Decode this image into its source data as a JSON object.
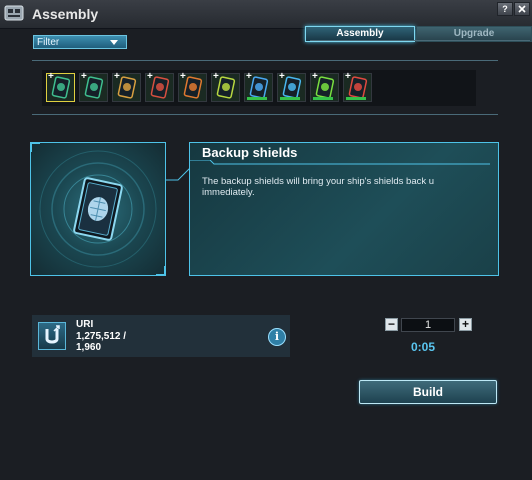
{
  "window": {
    "title": "Assembly",
    "help_label": "?",
    "close_label": "X"
  },
  "filter": {
    "label": "Filter"
  },
  "tabs": [
    {
      "label": "Assembly",
      "active": true
    },
    {
      "label": "Upgrade",
      "active": false
    }
  ],
  "items": [
    {
      "icon": "shield-card-icon",
      "color": "#3fbf8f",
      "selected": true,
      "plus": true,
      "has_progress": false
    },
    {
      "icon": "armor-card-icon",
      "color": "#3fbf8f",
      "selected": false,
      "plus": true,
      "has_progress": false
    },
    {
      "icon": "weapon-card-icon",
      "color": "#d8a040",
      "selected": false,
      "plus": true,
      "has_progress": false
    },
    {
      "icon": "repair-card-icon",
      "color": "#d85040",
      "selected": false,
      "plus": true,
      "has_progress": false
    },
    {
      "icon": "missile-card-icon",
      "color": "#e07a30",
      "selected": false,
      "plus": true,
      "has_progress": false
    },
    {
      "icon": "energy-card-icon",
      "color": "#b8d840",
      "selected": false,
      "plus": true,
      "has_progress": false
    },
    {
      "icon": "ice-card-icon",
      "color": "#4aa8f0",
      "selected": false,
      "plus": true,
      "has_progress": true
    },
    {
      "icon": "orb-card-icon",
      "color": "#4ab8f0",
      "selected": false,
      "plus": true,
      "has_progress": true
    },
    {
      "icon": "green-card-icon",
      "color": "#7ae040",
      "selected": false,
      "plus": true,
      "has_progress": true
    },
    {
      "icon": "fire-card-icon",
      "color": "#e04a40",
      "selected": false,
      "plus": true,
      "has_progress": true
    }
  ],
  "detail": {
    "title": "Backup shields",
    "description": "The backup shields will bring your ship's shields back u\nimmediately."
  },
  "resource": {
    "icon": "uridium-icon",
    "name": "URI",
    "amount": "1,275,512 /\n1,960"
  },
  "quantity": {
    "minus_label": "−",
    "value": "1",
    "plus_label": "+"
  },
  "timer": "0:05",
  "build_label": "Build",
  "colors": {
    "accent": "#4ec3e8",
    "timer": "#5ac6f0"
  }
}
